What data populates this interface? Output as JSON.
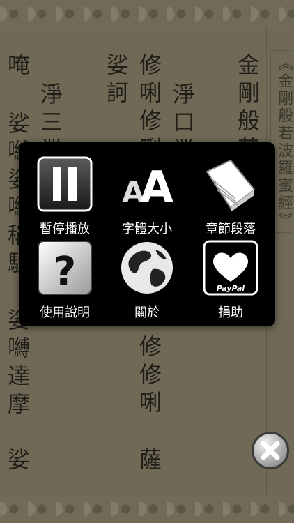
{
  "title": "《金剛般若波羅蜜經》",
  "columns": [
    {
      "key": "c1",
      "text": "金剛般若"
    },
    {
      "key": "c2",
      "text": "淨口業"
    },
    {
      "key": "c3",
      "text": "修唎修唎"
    },
    {
      "key": "c4",
      "text": "娑訶"
    },
    {
      "key": "c5",
      "text": "淨三業"
    },
    {
      "key": "c6",
      "text": "唵"
    },
    {
      "key": "c7",
      "text": "娑嚩娑嚩稱駄"
    },
    {
      "key": "c8",
      "text": "修修唎"
    },
    {
      "key": "c9",
      "text": "薩"
    },
    {
      "key": "c10",
      "text": "娑嚩達摩"
    },
    {
      "key": "c11",
      "text": "娑"
    }
  ],
  "menu": {
    "pause": "暫停播放",
    "font_size": "字體大小",
    "chapters": "章節段落",
    "help": "使用說明",
    "about": "關於",
    "donate": "捐助",
    "paypal": "PayPal"
  },
  "icons": {
    "pause": "pause-icon",
    "font_size": "font-size-icon",
    "chapters": "book-icon",
    "help": "help-icon",
    "about": "globe-icon",
    "donate": "heart-icon",
    "close": "close-icon"
  }
}
